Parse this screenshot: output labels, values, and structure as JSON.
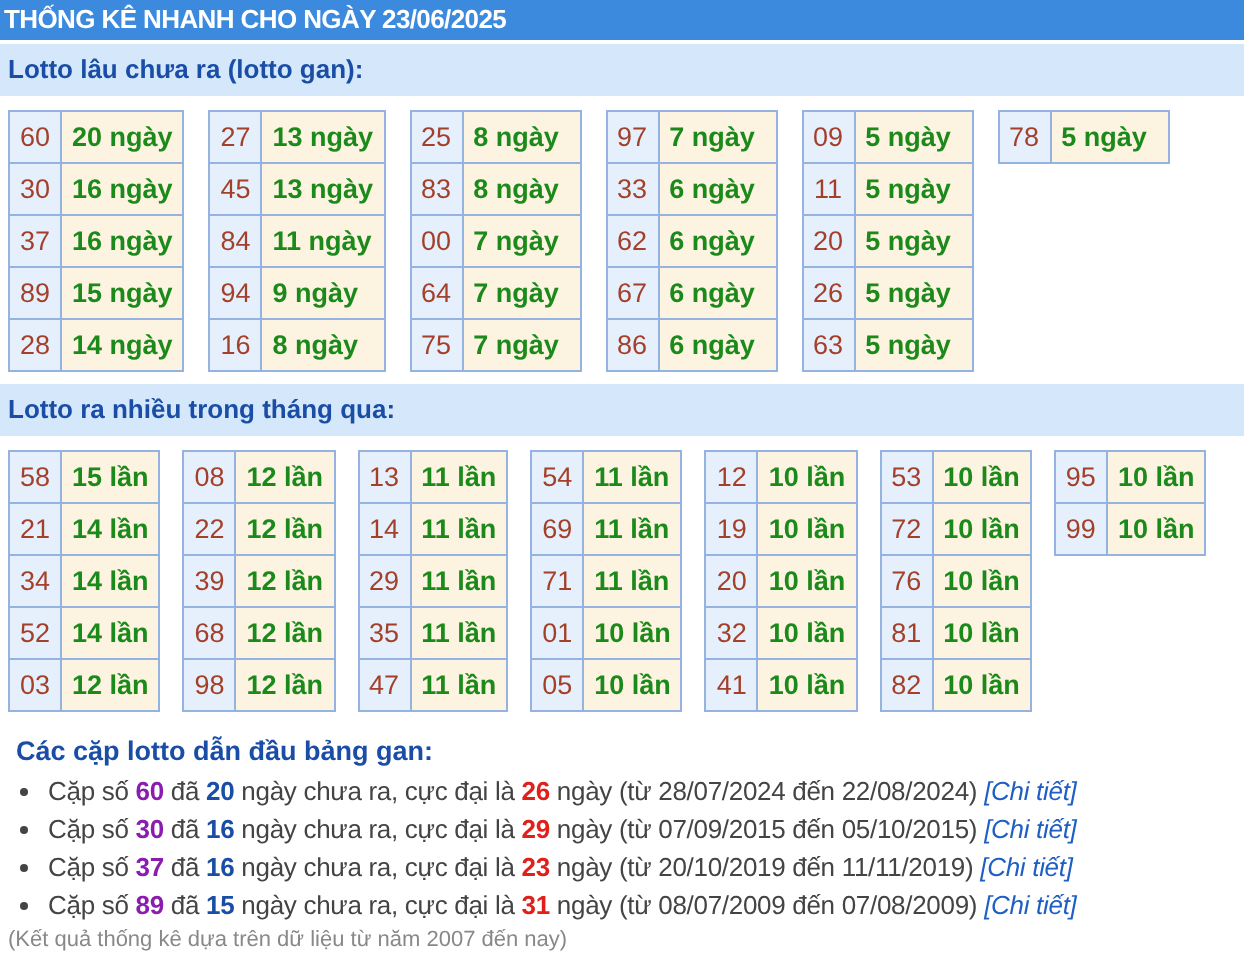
{
  "title": "THỐNG KÊ NHANH CHO NGÀY 23/06/2025",
  "sections": [
    {
      "heading": "Lotto lâu chưa ra (lotto gan):",
      "columns": [
        [
          {
            "number": "60",
            "value": "20 ngày"
          },
          {
            "number": "30",
            "value": "16 ngày"
          },
          {
            "number": "37",
            "value": "16 ngày"
          },
          {
            "number": "89",
            "value": "15 ngày"
          },
          {
            "number": "28",
            "value": "14 ngày"
          }
        ],
        [
          {
            "number": "27",
            "value": "13 ngày"
          },
          {
            "number": "45",
            "value": "13 ngày"
          },
          {
            "number": "84",
            "value": "11 ngày"
          },
          {
            "number": "94",
            "value": "9 ngày"
          },
          {
            "number": "16",
            "value": "8 ngày"
          }
        ],
        [
          {
            "number": "25",
            "value": "8 ngày"
          },
          {
            "number": "83",
            "value": "8 ngày"
          },
          {
            "number": "00",
            "value": "7 ngày"
          },
          {
            "number": "64",
            "value": "7 ngày"
          },
          {
            "number": "75",
            "value": "7 ngày"
          }
        ],
        [
          {
            "number": "97",
            "value": "7 ngày"
          },
          {
            "number": "33",
            "value": "6 ngày"
          },
          {
            "number": "62",
            "value": "6 ngày"
          },
          {
            "number": "67",
            "value": "6 ngày"
          },
          {
            "number": "86",
            "value": "6 ngày"
          }
        ],
        [
          {
            "number": "09",
            "value": "5 ngày"
          },
          {
            "number": "11",
            "value": "5 ngày"
          },
          {
            "number": "20",
            "value": "5 ngày"
          },
          {
            "number": "26",
            "value": "5 ngày"
          },
          {
            "number": "63",
            "value": "5 ngày"
          }
        ],
        [
          {
            "number": "78",
            "value": "5 ngày"
          }
        ]
      ]
    },
    {
      "heading": "Lotto ra nhiều trong tháng qua:",
      "columns": [
        [
          {
            "number": "58",
            "value": "15 lần"
          },
          {
            "number": "21",
            "value": "14 lần"
          },
          {
            "number": "34",
            "value": "14 lần"
          },
          {
            "number": "52",
            "value": "14 lần"
          },
          {
            "number": "03",
            "value": "12 lần"
          }
        ],
        [
          {
            "number": "08",
            "value": "12 lần"
          },
          {
            "number": "22",
            "value": "12 lần"
          },
          {
            "number": "39",
            "value": "12 lần"
          },
          {
            "number": "68",
            "value": "12 lần"
          },
          {
            "number": "98",
            "value": "12 lần"
          }
        ],
        [
          {
            "number": "13",
            "value": "11 lần"
          },
          {
            "number": "14",
            "value": "11 lần"
          },
          {
            "number": "29",
            "value": "11 lần"
          },
          {
            "number": "35",
            "value": "11 lần"
          },
          {
            "number": "47",
            "value": "11 lần"
          }
        ],
        [
          {
            "number": "54",
            "value": "11 lần"
          },
          {
            "number": "69",
            "value": "11 lần"
          },
          {
            "number": "71",
            "value": "11 lần"
          },
          {
            "number": "01",
            "value": "10 lần"
          },
          {
            "number": "05",
            "value": "10 lần"
          }
        ],
        [
          {
            "number": "12",
            "value": "10 lần"
          },
          {
            "number": "19",
            "value": "10 lần"
          },
          {
            "number": "20",
            "value": "10 lần"
          },
          {
            "number": "32",
            "value": "10 lần"
          },
          {
            "number": "41",
            "value": "10 lần"
          }
        ],
        [
          {
            "number": "53",
            "value": "10 lần"
          },
          {
            "number": "72",
            "value": "10 lần"
          },
          {
            "number": "76",
            "value": "10 lần"
          },
          {
            "number": "81",
            "value": "10 lần"
          },
          {
            "number": "82",
            "value": "10 lần"
          }
        ],
        [
          {
            "number": "95",
            "value": "10 lần"
          },
          {
            "number": "99",
            "value": "10 lần"
          }
        ]
      ]
    }
  ],
  "summary": {
    "heading": "Các cặp lotto dẫn đầu bảng gan:",
    "items": [
      [
        {
          "kind": "text",
          "text": "Cặp số "
        },
        {
          "kind": "pair",
          "text": "60"
        },
        {
          "kind": "text",
          "text": " đã "
        },
        {
          "kind": "days",
          "text": "20"
        },
        {
          "kind": "text",
          "text": " ngày chưa ra, cực đại là "
        },
        {
          "kind": "max",
          "text": "26"
        },
        {
          "kind": "text",
          "text": " ngày (từ 28/07/2024 đến 22/08/2024) "
        },
        {
          "kind": "link",
          "text": "[Chi tiết]"
        }
      ],
      [
        {
          "kind": "text",
          "text": "Cặp số "
        },
        {
          "kind": "pair",
          "text": "30"
        },
        {
          "kind": "text",
          "text": " đã "
        },
        {
          "kind": "days",
          "text": "16"
        },
        {
          "kind": "text",
          "text": " ngày chưa ra, cực đại là "
        },
        {
          "kind": "max",
          "text": "29"
        },
        {
          "kind": "text",
          "text": " ngày (từ 07/09/2015 đến 05/10/2015) "
        },
        {
          "kind": "link",
          "text": "[Chi tiết]"
        }
      ],
      [
        {
          "kind": "text",
          "text": "Cặp số "
        },
        {
          "kind": "pair",
          "text": "37"
        },
        {
          "kind": "text",
          "text": " đã "
        },
        {
          "kind": "days",
          "text": "16"
        },
        {
          "kind": "text",
          "text": " ngày chưa ra, cực đại là "
        },
        {
          "kind": "max",
          "text": "23"
        },
        {
          "kind": "text",
          "text": " ngày (từ 20/10/2019 đến 11/11/2019) "
        },
        {
          "kind": "link",
          "text": "[Chi tiết]"
        }
      ],
      [
        {
          "kind": "text",
          "text": "Cặp số "
        },
        {
          "kind": "pair",
          "text": "89"
        },
        {
          "kind": "text",
          "text": " đã "
        },
        {
          "kind": "days",
          "text": "15"
        },
        {
          "kind": "text",
          "text": " ngày chưa ra, cực đại là "
        },
        {
          "kind": "max",
          "text": "31"
        },
        {
          "kind": "text",
          "text": " ngày (từ 08/07/2009 đến 07/08/2009) "
        },
        {
          "kind": "link",
          "text": "[Chi tiết]"
        }
      ]
    ],
    "note": "(Kết quả thống kê dựa trên dữ liệu từ năm 2007 đến nay)"
  }
}
